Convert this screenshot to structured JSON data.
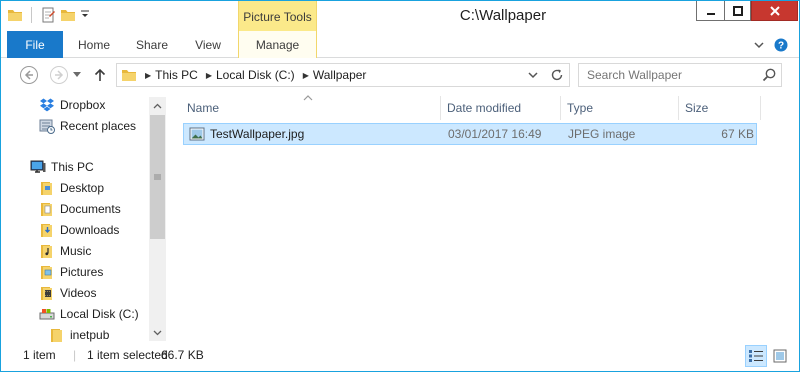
{
  "window": {
    "title": "C:\\Wallpaper",
    "context_tab_group": "Picture Tools"
  },
  "ribbon": {
    "tabs": [
      {
        "label": "File"
      },
      {
        "label": "Home"
      },
      {
        "label": "Share"
      },
      {
        "label": "View"
      },
      {
        "label": "Manage"
      }
    ]
  },
  "address": {
    "crumbs": [
      "This PC",
      "Local Disk (C:)",
      "Wallpaper"
    ]
  },
  "search": {
    "placeholder": "Search Wallpaper"
  },
  "sidebar": {
    "items": [
      {
        "label": "Dropbox",
        "icon": "dropbox-icon"
      },
      {
        "label": "Recent places",
        "icon": "recent-places-icon"
      },
      {
        "label": "This PC",
        "icon": "computer-icon"
      },
      {
        "label": "Desktop",
        "icon": "folder-icon"
      },
      {
        "label": "Documents",
        "icon": "folder-icon"
      },
      {
        "label": "Downloads",
        "icon": "folder-icon"
      },
      {
        "label": "Music",
        "icon": "folder-icon"
      },
      {
        "label": "Pictures",
        "icon": "folder-icon"
      },
      {
        "label": "Videos",
        "icon": "folder-icon"
      },
      {
        "label": "Local Disk (C:)",
        "icon": "drive-icon"
      },
      {
        "label": "inetpub",
        "icon": "folder-icon"
      }
    ]
  },
  "columns": [
    {
      "label": "Name"
    },
    {
      "label": "Date modified"
    },
    {
      "label": "Type"
    },
    {
      "label": "Size"
    }
  ],
  "files": [
    {
      "name": "TestWallpaper.jpg",
      "date_modified": "03/01/2017 16:49",
      "type": "JPEG image",
      "size": "67 KB",
      "selected": true
    }
  ],
  "status": {
    "item_count": "1 item",
    "selection": "1 item selected",
    "selection_size": "66.7 KB"
  },
  "colors": {
    "accent": "#1979ca",
    "context_tab": "#fbe98a",
    "selection": "#cce8ff",
    "close_button": "#c7372f"
  }
}
